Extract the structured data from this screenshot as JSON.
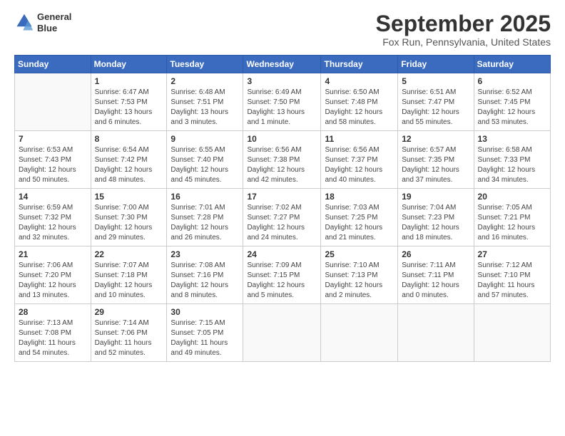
{
  "header": {
    "logo_line1": "General",
    "logo_line2": "Blue",
    "month": "September 2025",
    "location": "Fox Run, Pennsylvania, United States"
  },
  "weekdays": [
    "Sunday",
    "Monday",
    "Tuesday",
    "Wednesday",
    "Thursday",
    "Friday",
    "Saturday"
  ],
  "weeks": [
    [
      {
        "day": "",
        "sunrise": "",
        "sunset": "",
        "daylight": ""
      },
      {
        "day": "1",
        "sunrise": "Sunrise: 6:47 AM",
        "sunset": "Sunset: 7:53 PM",
        "daylight": "Daylight: 13 hours and 6 minutes."
      },
      {
        "day": "2",
        "sunrise": "Sunrise: 6:48 AM",
        "sunset": "Sunset: 7:51 PM",
        "daylight": "Daylight: 13 hours and 3 minutes."
      },
      {
        "day": "3",
        "sunrise": "Sunrise: 6:49 AM",
        "sunset": "Sunset: 7:50 PM",
        "daylight": "Daylight: 13 hours and 1 minute."
      },
      {
        "day": "4",
        "sunrise": "Sunrise: 6:50 AM",
        "sunset": "Sunset: 7:48 PM",
        "daylight": "Daylight: 12 hours and 58 minutes."
      },
      {
        "day": "5",
        "sunrise": "Sunrise: 6:51 AM",
        "sunset": "Sunset: 7:47 PM",
        "daylight": "Daylight: 12 hours and 55 minutes."
      },
      {
        "day": "6",
        "sunrise": "Sunrise: 6:52 AM",
        "sunset": "Sunset: 7:45 PM",
        "daylight": "Daylight: 12 hours and 53 minutes."
      }
    ],
    [
      {
        "day": "7",
        "sunrise": "Sunrise: 6:53 AM",
        "sunset": "Sunset: 7:43 PM",
        "daylight": "Daylight: 12 hours and 50 minutes."
      },
      {
        "day": "8",
        "sunrise": "Sunrise: 6:54 AM",
        "sunset": "Sunset: 7:42 PM",
        "daylight": "Daylight: 12 hours and 48 minutes."
      },
      {
        "day": "9",
        "sunrise": "Sunrise: 6:55 AM",
        "sunset": "Sunset: 7:40 PM",
        "daylight": "Daylight: 12 hours and 45 minutes."
      },
      {
        "day": "10",
        "sunrise": "Sunrise: 6:56 AM",
        "sunset": "Sunset: 7:38 PM",
        "daylight": "Daylight: 12 hours and 42 minutes."
      },
      {
        "day": "11",
        "sunrise": "Sunrise: 6:56 AM",
        "sunset": "Sunset: 7:37 PM",
        "daylight": "Daylight: 12 hours and 40 minutes."
      },
      {
        "day": "12",
        "sunrise": "Sunrise: 6:57 AM",
        "sunset": "Sunset: 7:35 PM",
        "daylight": "Daylight: 12 hours and 37 minutes."
      },
      {
        "day": "13",
        "sunrise": "Sunrise: 6:58 AM",
        "sunset": "Sunset: 7:33 PM",
        "daylight": "Daylight: 12 hours and 34 minutes."
      }
    ],
    [
      {
        "day": "14",
        "sunrise": "Sunrise: 6:59 AM",
        "sunset": "Sunset: 7:32 PM",
        "daylight": "Daylight: 12 hours and 32 minutes."
      },
      {
        "day": "15",
        "sunrise": "Sunrise: 7:00 AM",
        "sunset": "Sunset: 7:30 PM",
        "daylight": "Daylight: 12 hours and 29 minutes."
      },
      {
        "day": "16",
        "sunrise": "Sunrise: 7:01 AM",
        "sunset": "Sunset: 7:28 PM",
        "daylight": "Daylight: 12 hours and 26 minutes."
      },
      {
        "day": "17",
        "sunrise": "Sunrise: 7:02 AM",
        "sunset": "Sunset: 7:27 PM",
        "daylight": "Daylight: 12 hours and 24 minutes."
      },
      {
        "day": "18",
        "sunrise": "Sunrise: 7:03 AM",
        "sunset": "Sunset: 7:25 PM",
        "daylight": "Daylight: 12 hours and 21 minutes."
      },
      {
        "day": "19",
        "sunrise": "Sunrise: 7:04 AM",
        "sunset": "Sunset: 7:23 PM",
        "daylight": "Daylight: 12 hours and 18 minutes."
      },
      {
        "day": "20",
        "sunrise": "Sunrise: 7:05 AM",
        "sunset": "Sunset: 7:21 PM",
        "daylight": "Daylight: 12 hours and 16 minutes."
      }
    ],
    [
      {
        "day": "21",
        "sunrise": "Sunrise: 7:06 AM",
        "sunset": "Sunset: 7:20 PM",
        "daylight": "Daylight: 12 hours and 13 minutes."
      },
      {
        "day": "22",
        "sunrise": "Sunrise: 7:07 AM",
        "sunset": "Sunset: 7:18 PM",
        "daylight": "Daylight: 12 hours and 10 minutes."
      },
      {
        "day": "23",
        "sunrise": "Sunrise: 7:08 AM",
        "sunset": "Sunset: 7:16 PM",
        "daylight": "Daylight: 12 hours and 8 minutes."
      },
      {
        "day": "24",
        "sunrise": "Sunrise: 7:09 AM",
        "sunset": "Sunset: 7:15 PM",
        "daylight": "Daylight: 12 hours and 5 minutes."
      },
      {
        "day": "25",
        "sunrise": "Sunrise: 7:10 AM",
        "sunset": "Sunset: 7:13 PM",
        "daylight": "Daylight: 12 hours and 2 minutes."
      },
      {
        "day": "26",
        "sunrise": "Sunrise: 7:11 AM",
        "sunset": "Sunset: 7:11 PM",
        "daylight": "Daylight: 12 hours and 0 minutes."
      },
      {
        "day": "27",
        "sunrise": "Sunrise: 7:12 AM",
        "sunset": "Sunset: 7:10 PM",
        "daylight": "Daylight: 11 hours and 57 minutes."
      }
    ],
    [
      {
        "day": "28",
        "sunrise": "Sunrise: 7:13 AM",
        "sunset": "Sunset: 7:08 PM",
        "daylight": "Daylight: 11 hours and 54 minutes."
      },
      {
        "day": "29",
        "sunrise": "Sunrise: 7:14 AM",
        "sunset": "Sunset: 7:06 PM",
        "daylight": "Daylight: 11 hours and 52 minutes."
      },
      {
        "day": "30",
        "sunrise": "Sunrise: 7:15 AM",
        "sunset": "Sunset: 7:05 PM",
        "daylight": "Daylight: 11 hours and 49 minutes."
      },
      {
        "day": "",
        "sunrise": "",
        "sunset": "",
        "daylight": ""
      },
      {
        "day": "",
        "sunrise": "",
        "sunset": "",
        "daylight": ""
      },
      {
        "day": "",
        "sunrise": "",
        "sunset": "",
        "daylight": ""
      },
      {
        "day": "",
        "sunrise": "",
        "sunset": "",
        "daylight": ""
      }
    ]
  ]
}
